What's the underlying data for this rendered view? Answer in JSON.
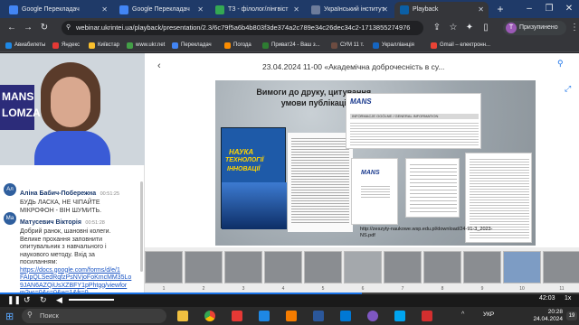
{
  "tabs": [
    {
      "label": "Google Перекладач",
      "active": false
    },
    {
      "label": "Google Перекладач",
      "active": false
    },
    {
      "label": "ТЗ - філолог/лінгвіст",
      "active": false
    },
    {
      "label": "Український інститут",
      "active": false
    },
    {
      "label": "Playback",
      "active": true
    }
  ],
  "new_tab": "+",
  "address_bar": {
    "url": "webinar.ukrintei.ua/playback/presentation/2.3/6c79f5a6b4b803f3de374a2c789e34c26dec34c2-1713855274976"
  },
  "profile": {
    "initial": "T",
    "label": "Призупинено"
  },
  "bookmarks": [
    "Авиабилеты",
    "Яндекс",
    "Київстар",
    "www.ukr.net",
    "Перекладач",
    "Погода",
    "Приват24 - Ваш з...",
    "СУМ 11 т.",
    "Укралліанція",
    "Gmail – електронн..."
  ],
  "video": {
    "banner_top": "MANS",
    "banner_bottom": "LOMZA"
  },
  "chat": {
    "messages": [
      {
        "initials": "Ал",
        "name": "Аліна Бабич-Побережна",
        "time": "00:51:25",
        "lines": [
          "БУДЬ ЛАСКА, НЕ ЧІПАЙТЕ",
          "МІКРОФОН - ВІН ШУМИТЬ."
        ]
      },
      {
        "initials": "Ма",
        "name": "Матусевич Вікторія",
        "time": "00:51:28",
        "lines": [
          "Добрий ранок, шановні колеги.",
          "Велике прохання заповнити",
          "опитувальник з навчального і",
          "наукового методу. Вхід за",
          "посиланням:"
        ]
      }
    ],
    "link_lines": [
      "https://docs.google.com/forms/d/e/1",
      "FAIpQLSedRqfzPsNVjoFoKmcMM35Lo",
      "9JAN6AZQiUsXZBFY1pPhtgg/viewfor",
      "m?vc=0&c=0&w=1&fr=0"
    ]
  },
  "presentation": {
    "title": "23.04.2024 11-00 «Академічна доброчесність в су...",
    "slide_heading_line1": "Вимоги до друку, цитування,",
    "slide_heading_line2": "умови публікації",
    "journal_cover_line1": "НАУКА",
    "journal_cover_line2": "ТЕХНОЛОГІЇ",
    "journal_cover_line3": "ІННОВАЦІЇ",
    "mans_logo": "MANS",
    "info_header": "INFORMACJE OGÓLNE / GENERAL INFORMATION",
    "slide_link_line1": "http://zeszyty-naukowe.wsp.edu.pl/download/24-91-3_2023-",
    "slide_link_line2": "NS.pdf"
  },
  "thumbnails": [
    "1",
    "2",
    "3",
    "4",
    "5",
    "6",
    "7",
    "8",
    "9",
    "10",
    "11",
    "12"
  ],
  "player": {
    "time": "42:03",
    "speed": "1x"
  },
  "taskbar": {
    "search": "Поиск",
    "lang": "УКР",
    "time": "20:28",
    "date": "24.04.2024",
    "notifications": "19"
  }
}
